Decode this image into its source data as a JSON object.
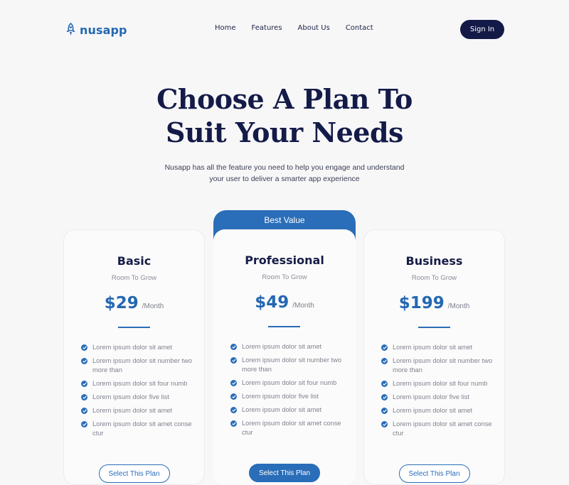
{
  "brand": {
    "name": "nusapp",
    "color": "#2468b2"
  },
  "nav": {
    "items": [
      "Home",
      "Features",
      "About Us",
      "Contact"
    ],
    "signin_label": "Sign In"
  },
  "hero": {
    "title_line1": "Choose A Plan To",
    "title_line2": "Suit Your Needs",
    "subtitle_line1": "Nusapp has all the feature you need to help you engage and understand",
    "subtitle_line2": "your user to deliver a smarter app experience"
  },
  "featured_badge": "Best Value",
  "plans": [
    {
      "name": "Basic",
      "tagline": "Room To Grow",
      "price": "$29",
      "period": "/Month",
      "features": [
        "Lorem ipsum dolor sit amet",
        "Lorem ipsum dolor sit number two more than",
        "Lorem ipsum dolor sit four numb",
        "Lorem ipsum dolor five list",
        "Lorem ipsum dolor sit amet",
        "Lorem ipsum dolor sit amet conse ctur"
      ],
      "button": "Select This Plan",
      "featured": false
    },
    {
      "name": "Professional",
      "tagline": "Room To Grow",
      "price": "$49",
      "period": "/Month",
      "features": [
        "Lorem ipsum dolor sit amet",
        "Lorem ipsum dolor sit number two more than",
        "Lorem ipsum dolor sit four numb",
        "Lorem ipsum dolor five list",
        "Lorem ipsum dolor sit amet",
        "Lorem ipsum dolor sit amet conse ctur"
      ],
      "button": "Select This Plan",
      "featured": true
    },
    {
      "name": "Business",
      "tagline": "Room To Grow",
      "price": "$199",
      "period": "/Month",
      "features": [
        "Lorem ipsum dolor sit amet",
        "Lorem ipsum dolor sit number two more than",
        "Lorem ipsum dolor sit four numb",
        "Lorem ipsum dolor five list",
        "Lorem ipsum dolor sit amet",
        "Lorem ipsum dolor sit amet conse ctur"
      ],
      "button": "Select This Plan",
      "featured": false
    }
  ],
  "icons": {
    "logo": "rocket-icon",
    "feature": "check-circle-icon"
  }
}
